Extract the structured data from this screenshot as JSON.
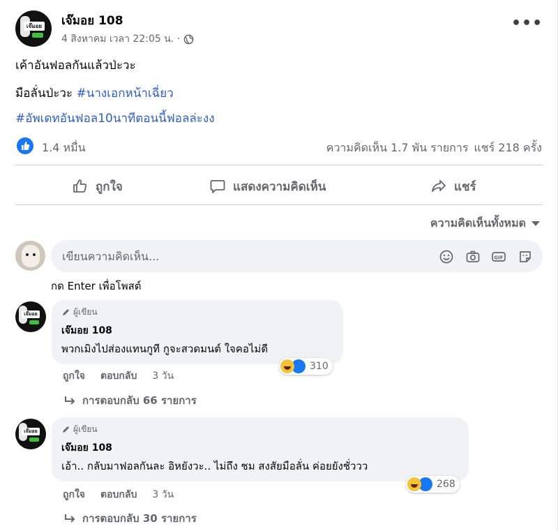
{
  "post": {
    "page_name": "เจ๊มอย 108",
    "time": "4 สิงหาคม เวลา 22:05 น. ·",
    "more_label": "•••",
    "line1": "เค้าอันฟอลกันแล้วป่ะวะ",
    "line2_text": "มือลั่นป่ะวะ ",
    "line2_hashtag": "#นางเอกหน้าเฉี่ยว",
    "line3_hashtag": "#อัพเดทอันฟอล10นาทีตอนนี้ฟอลล่ะงง",
    "likes": "1.4 หมื่น",
    "comments_count": "ความคิดเห็น 1.7 พัน รายการ",
    "shares_count": "แชร์ 218 ครั้ง"
  },
  "actions": {
    "like": "ถูกใจ",
    "comment": "แสดงความคิดเห็น",
    "share": "แชร์"
  },
  "filter_label": "ความคิดเห็นทั้งหมด",
  "composer": {
    "placeholder": "เขียนความคิดเห็น...",
    "hint": "กด Enter เพื่อโพสต์"
  },
  "comments": [
    {
      "badge": "ผู้เขียน",
      "author": "เจ๊มอย 108",
      "text": "พวกเมิงไปส่องแทนกูที กูจะสวดมนต์ ใจคอไม่ดี",
      "reactions": "310",
      "like": "ถูกใจ",
      "reply": "ตอบกลับ",
      "time": "3 วัน",
      "replies": "การตอบกลับ 66 รายการ"
    },
    {
      "badge": "ผู้เขียน",
      "author": "เจ๊มอย 108",
      "text": "เอ้า.. กลับมาฟอลกันละ อิหยังวะ.. ไม่ถึง ชม สงสัยมือลั่น ค่อยยังชั่ววว",
      "reactions": "268",
      "like": "ถูกใจ",
      "reply": "ตอบกลับ",
      "time": "3 วัน",
      "replies": "การตอบกลับ 30 รายการ"
    }
  ],
  "colors": {
    "accent": "#1877f2",
    "hashtag": "#2d5ec6",
    "muted": "#65676b",
    "bubble": "#f0f2f5"
  }
}
